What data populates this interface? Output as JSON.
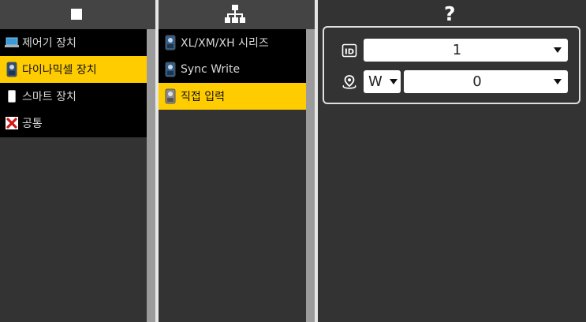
{
  "colors": {
    "background": "#333333",
    "list_background": "#000000",
    "selected": "#ffcc00",
    "scrollbar": "#9b9b9b"
  },
  "pane1": {
    "header_icon": "stop-square-icon",
    "items": [
      {
        "label": "제어기 장치",
        "icon": "laptop-icon"
      },
      {
        "label": "다이나믹셀 장치",
        "icon": "dynamixel-icon",
        "selected": true
      },
      {
        "label": "스마트 장치",
        "icon": "smartphone-icon"
      },
      {
        "label": "공통",
        "icon": "common-x-icon"
      }
    ]
  },
  "pane2": {
    "header_icon": "network-tree-icon",
    "items": [
      {
        "label": "XL/XM/XH 시리즈",
        "icon": "dynamixel-icon"
      },
      {
        "label": "Sync Write",
        "icon": "dynamixel-icon"
      },
      {
        "label": "직접 입력",
        "icon": "dynamixel-icon",
        "selected": true
      }
    ]
  },
  "pane3": {
    "header_text": "?",
    "id_row": {
      "icon_text": "ID",
      "value": "1"
    },
    "address_row": {
      "width_value": "W",
      "value": "0"
    }
  }
}
